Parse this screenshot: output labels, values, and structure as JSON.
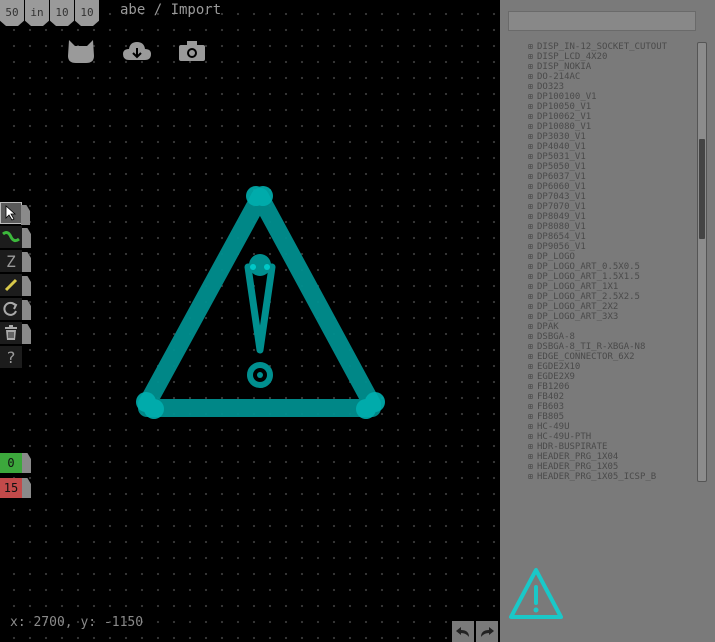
{
  "header": {
    "title": "abe / Import"
  },
  "grid_settings": {
    "size": "50",
    "units": "in",
    "a": "10",
    "b": "10"
  },
  "top_icons": [
    "cat-icon",
    "cloud-download-icon",
    "camera-icon"
  ],
  "tools": [
    "pointer-icon",
    "trace-icon",
    "text-icon",
    "ruler-icon",
    "rotate-icon",
    "trash-icon",
    "help-icon"
  ],
  "tool_labels": {
    "text": "Z",
    "help": "?"
  },
  "layers": [
    {
      "label": "0",
      "color": "#3ca83c"
    },
    {
      "label": "15",
      "color": "#c34a4a"
    }
  ],
  "status": {
    "coords": "x: 2700, y: -1150"
  },
  "colors": {
    "accent": "#00a0a0",
    "canvas": "#000000",
    "panel": "#7a7a7a"
  },
  "part_list": [
    "DISP_IN-12_SOCKET_CUTOUT",
    "DISP_LCD_4X20",
    "DISP_NOKIA",
    "DO-214AC",
    "DO323",
    "DP100100_V1",
    "DP10050_V1",
    "DP10062_V1",
    "DP10080_V1",
    "DP3030_V1",
    "DP4040_V1",
    "DP5031_V1",
    "DP5050_V1",
    "DP6037_V1",
    "DP6060_V1",
    "DP7043_V1",
    "DP7070_V1",
    "DP8049_V1",
    "DP8080_V1",
    "DP8654_V1",
    "DP9056_V1",
    "DP_LOGO",
    "DP_LOGO_ART_0.5X0.5",
    "DP_LOGO_ART_1.5X1.5",
    "DP_LOGO_ART_1X1",
    "DP_LOGO_ART_2.5X2.5",
    "DP_LOGO_ART_2X2",
    "DP_LOGO_ART_3X3",
    "DPAK",
    "DSBGA-8",
    "DSBGA-8_TI_R-XBGA-N8",
    "EDGE_CONNECTOR_6X2",
    "EGDE2X10",
    "EGDE2X9",
    "FB1206",
    "FB402",
    "FB603",
    "FB805",
    "HC-49U",
    "HC-49U-PTH",
    "HDR-BUSPIRATE",
    "HEADER_PRG_1X04",
    "HEADER_PRG_1X05",
    "HEADER_PRG_1X05_ICSP_B"
  ]
}
